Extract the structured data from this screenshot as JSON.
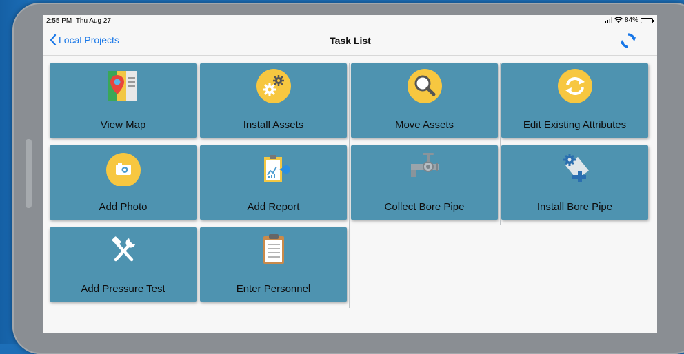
{
  "status": {
    "time": "2:55 PM",
    "date": "Thu Aug 27",
    "battery": "84%"
  },
  "nav": {
    "back_label": "Local Projects",
    "title": "Task List"
  },
  "tiles": [
    {
      "label": "View Map",
      "icon": "map-pin-icon"
    },
    {
      "label": "Install Assets",
      "icon": "gears-icon"
    },
    {
      "label": "Move Assets",
      "icon": "magnifier-icon"
    },
    {
      "label": "Edit Existing Attributes",
      "icon": "refresh-icon"
    },
    {
      "label": "Add Photo",
      "icon": "camera-icon"
    },
    {
      "label": "Add Report",
      "icon": "report-icon"
    },
    {
      "label": "Collect Bore Pipe",
      "icon": "pipe-valve-icon"
    },
    {
      "label": "Install Bore Pipe",
      "icon": "pipe-gear-icon"
    },
    {
      "label": "Add Pressure Test",
      "icon": "tools-icon"
    },
    {
      "label": "Enter Personnel",
      "icon": "clipboard-icon"
    }
  ],
  "colors": {
    "tile": "#4e93b0",
    "accent": "#1877e8",
    "icon_yellow": "#f7c740"
  }
}
